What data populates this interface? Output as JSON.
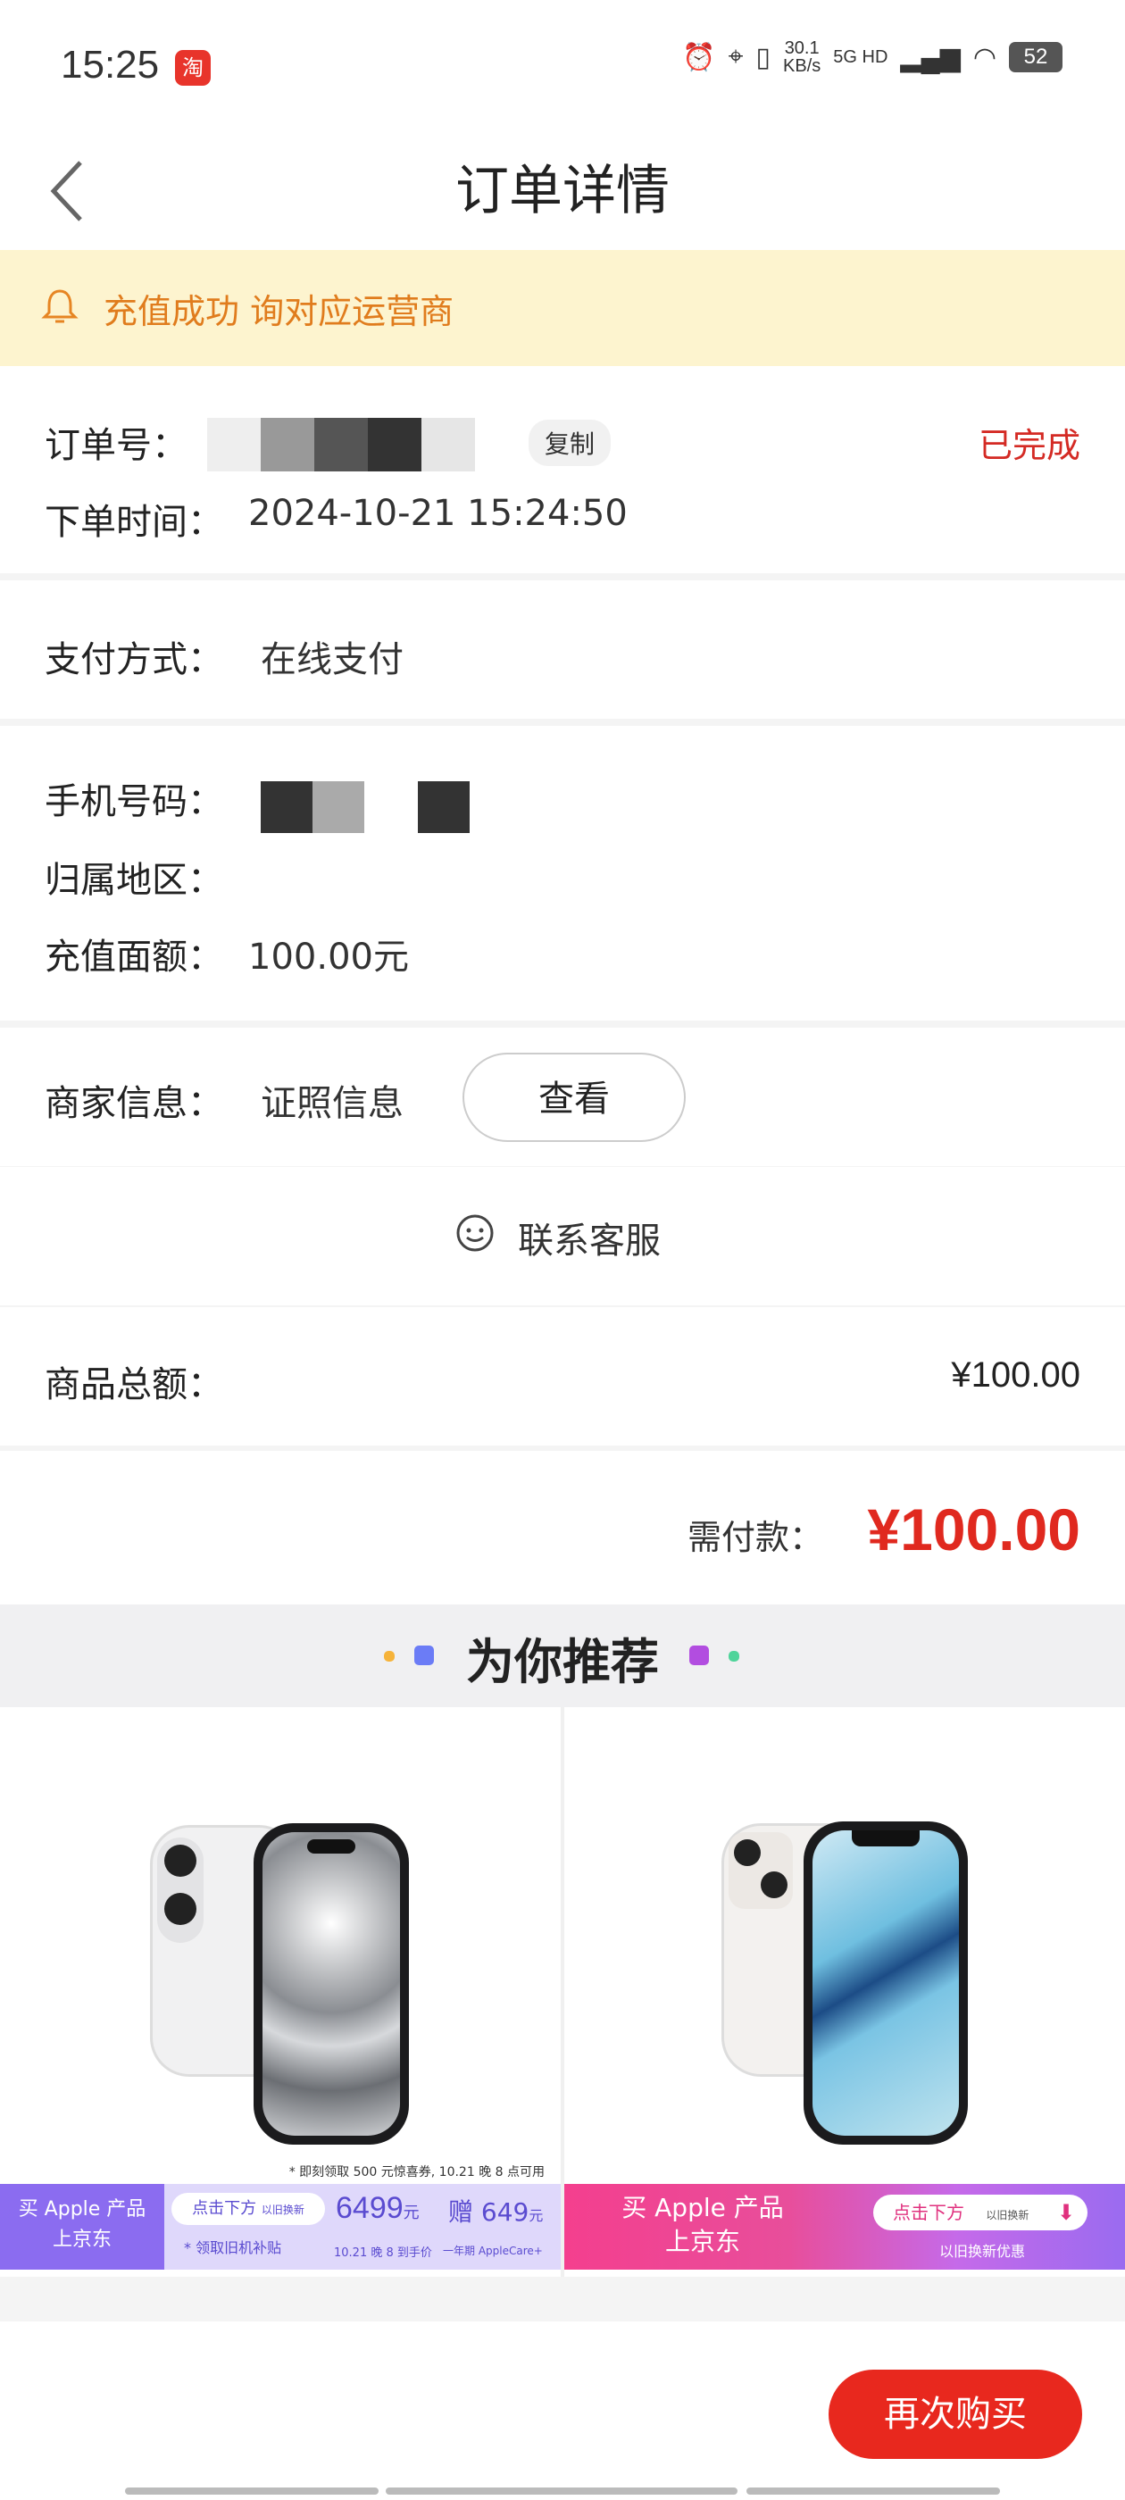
{
  "status_bar": {
    "time": "15:25",
    "app_badge": "淘",
    "net_speed": "30.1",
    "net_unit": "KB/s",
    "signal": "5G HD",
    "battery": "52"
  },
  "nav": {
    "title": "订单详情"
  },
  "notice": {
    "text": "充值成功        询对应运营商"
  },
  "order": {
    "order_no_label": "订单号：",
    "copy_label": "复制",
    "status": "已完成",
    "time_label": "下单时间：",
    "time_value": "2024-10-21 15:24:50",
    "pay_method_label": "支付方式：",
    "pay_method_value": "在线支付",
    "phone_label": "手机号码：",
    "region_label": "归属地区：",
    "amount_label": "充值面额：",
    "amount_value": "100.00元",
    "merchant_label": "商家信息：",
    "merchant_value": "证照信息",
    "view_label": "查看",
    "contact_label": "联系客服",
    "total_label": "商品总额：",
    "total_value": "¥100.00",
    "pay_label": "需付款：",
    "pay_value": "¥100.00"
  },
  "recommend": {
    "title": "为你推荐",
    "products": [
      {
        "banner_left_line1": "买 Apple 产品",
        "banner_left_line2": "上京东",
        "banner_mid_line1": "点击下方",
        "banner_mid_tag": "以旧换新",
        "banner_mid_line2": "* 领取旧机补贴",
        "price": "6499",
        "price_unit": "元",
        "price_note": "10.21 晚 8 到手价",
        "gift": "赠 649",
        "gift_unit": "元",
        "gift_note": "一年期 AppleCare+",
        "footnote": "* 即刻领取 500 元惊喜券, 10.21 晚 8 点可用"
      },
      {
        "banner_left_line1": "买 Apple 产品",
        "banner_left_line2": "上京东",
        "banner_mid_line1": "点击下方",
        "banner_mid_tag": "以旧换新",
        "banner_mid_line2": "以旧换新优惠"
      }
    ]
  },
  "footer": {
    "buy_again": "再次购买"
  }
}
